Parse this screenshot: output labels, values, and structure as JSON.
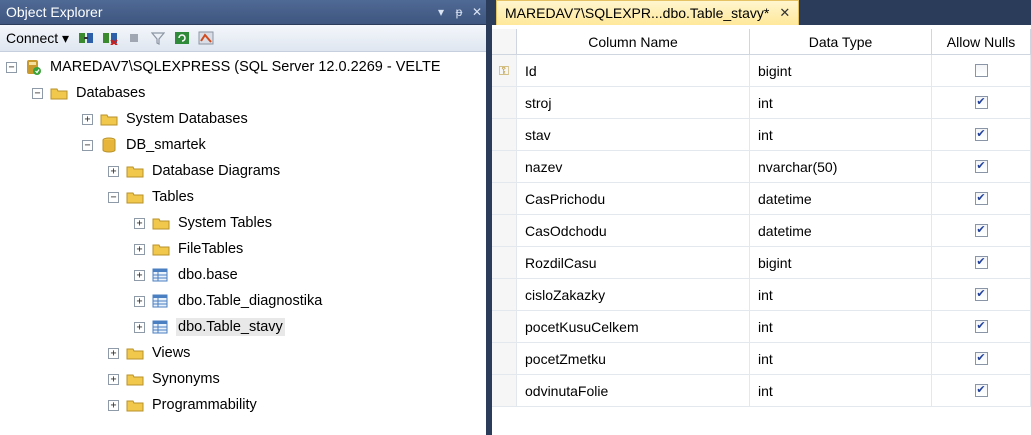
{
  "object_explorer": {
    "title": "Object Explorer",
    "controls": [
      "▾",
      "ᵽ",
      "✕"
    ],
    "toolbar": {
      "connect_label": "Connect ▾"
    },
    "tree": [
      {
        "name": "server",
        "label": "MAREDAV7\\SQLEXPRESS (SQL Server 12.0.2269 - VELTE",
        "icon": "server-icon",
        "expander": "−",
        "level": 0
      },
      {
        "name": "databases",
        "label": "Databases",
        "icon": "folder-icon",
        "expander": "−",
        "level": 1
      },
      {
        "name": "system-databases",
        "label": "System Databases",
        "icon": "folder-icon",
        "expander": "+",
        "level": 2
      },
      {
        "name": "db-smartek",
        "label": "DB_smartek",
        "icon": "database-icon",
        "expander": "−",
        "level": 2
      },
      {
        "name": "database-diagrams",
        "label": "Database Diagrams",
        "icon": "folder-icon",
        "expander": "+",
        "level": 3
      },
      {
        "name": "tables",
        "label": "Tables",
        "icon": "folder-icon",
        "expander": "−",
        "level": 3
      },
      {
        "name": "system-tables",
        "label": "System Tables",
        "icon": "folder-icon",
        "expander": "+",
        "level": 4
      },
      {
        "name": "filetables",
        "label": "FileTables",
        "icon": "folder-icon",
        "expander": "+",
        "level": 4
      },
      {
        "name": "dbo-base",
        "label": "dbo.base",
        "icon": "table-icon",
        "expander": "+",
        "level": 4
      },
      {
        "name": "dbo-table-diagnostika",
        "label": "dbo.Table_diagnostika",
        "icon": "table-icon",
        "expander": "+",
        "level": 4
      },
      {
        "name": "dbo-table-stavy",
        "label": "dbo.Table_stavy",
        "icon": "table-icon",
        "expander": "+",
        "level": 4,
        "selected": true
      },
      {
        "name": "views",
        "label": "Views",
        "icon": "folder-icon",
        "expander": "+",
        "level": 3
      },
      {
        "name": "synonyms",
        "label": "Synonyms",
        "icon": "folder-icon",
        "expander": "+",
        "level": 3
      },
      {
        "name": "programmability",
        "label": "Programmability",
        "icon": "folder-icon",
        "expander": "+",
        "level": 3
      }
    ]
  },
  "designer": {
    "tab_label": "MAREDAV7\\SQLEXPR...dbo.Table_stavy*",
    "tab_close": "✕",
    "headers": {
      "column_name": "Column Name",
      "data_type": "Data Type",
      "allow_nulls": "Allow Nulls"
    },
    "rows": [
      {
        "name": "Id",
        "type": "bigint",
        "nulls": false,
        "key": true
      },
      {
        "name": "stroj",
        "type": "int",
        "nulls": true
      },
      {
        "name": "stav",
        "type": "int",
        "nulls": true
      },
      {
        "name": "nazev",
        "type": "nvarchar(50)",
        "nulls": true
      },
      {
        "name": "CasPrichodu",
        "type": "datetime",
        "nulls": true
      },
      {
        "name": "CasOdchodu",
        "type": "datetime",
        "nulls": true
      },
      {
        "name": "RozdilCasu",
        "type": "bigint",
        "nulls": true
      },
      {
        "name": "cisloZakazky",
        "type": "int",
        "nulls": true
      },
      {
        "name": "pocetKusuCelkem",
        "type": "int",
        "nulls": true
      },
      {
        "name": "pocetZmetku",
        "type": "int",
        "nulls": true
      },
      {
        "name": "odvinutaFolie",
        "type": "int",
        "nulls": true
      }
    ]
  }
}
